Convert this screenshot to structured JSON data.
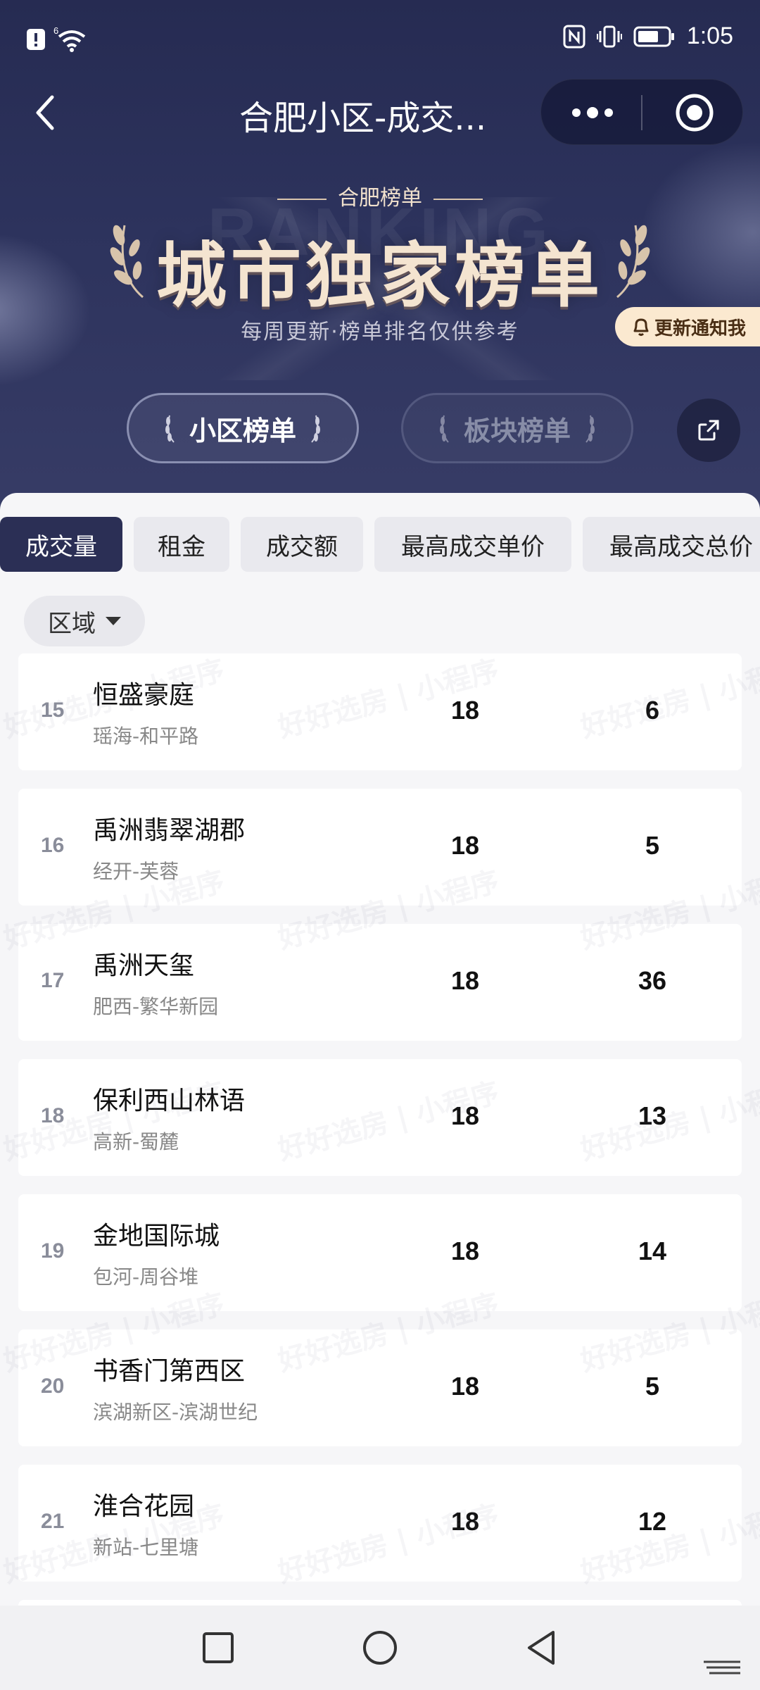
{
  "status_bar": {
    "time": "1:05",
    "network": "6",
    "icons": [
      "alert-icon",
      "wifi-icon",
      "nfc-icon",
      "vibrate-icon",
      "battery-icon"
    ]
  },
  "nav": {
    "title": "合肥小区-成交...",
    "icons": [
      "back-icon",
      "more-icon",
      "target-icon"
    ]
  },
  "banner": {
    "subtitle": "合肥榜单",
    "title": "城市独家榜单",
    "description": "每周更新·榜单排名仅供参考",
    "notify_label": "更新通知我"
  },
  "top_tabs": [
    {
      "label": "小区榜单",
      "active": true
    },
    {
      "label": "板块榜单",
      "active": false
    }
  ],
  "category_tabs": [
    {
      "label": "成交量",
      "active": true
    },
    {
      "label": "租金",
      "active": false
    },
    {
      "label": "成交额",
      "active": false
    },
    {
      "label": "最高成交单价",
      "active": false
    },
    {
      "label": "最高成交总价",
      "active": false
    }
  ],
  "filter": {
    "label": "区域"
  },
  "watermark": {
    "text": "好好选房 | 小程序"
  },
  "rows": [
    {
      "rank": "15",
      "name": "恒盛豪庭",
      "area": "瑶海-和平路",
      "v1": "18",
      "v2": "6"
    },
    {
      "rank": "16",
      "name": "禹洲翡翠湖郡",
      "area": "经开-芙蓉",
      "v1": "18",
      "v2": "5"
    },
    {
      "rank": "17",
      "name": "禹洲天玺",
      "area": "肥西-繁华新园",
      "v1": "18",
      "v2": "36"
    },
    {
      "rank": "18",
      "name": "保利西山林语",
      "area": "高新-蜀麓",
      "v1": "18",
      "v2": "13"
    },
    {
      "rank": "19",
      "name": "金地国际城",
      "area": "包河-周谷堆",
      "v1": "18",
      "v2": "14"
    },
    {
      "rank": "20",
      "name": "书香门第西区",
      "area": "滨湖新区-滨湖世纪",
      "v1": "18",
      "v2": "5"
    },
    {
      "rank": "21",
      "name": "淮合花园",
      "area": "新站-七里塘",
      "v1": "18",
      "v2": "12"
    }
  ],
  "colors": {
    "header_bg": "#2d335d",
    "active_tab_bg": "#2b2f55",
    "notify_bg": "#fbe9d0",
    "banner_title": "#f4e4d0"
  }
}
